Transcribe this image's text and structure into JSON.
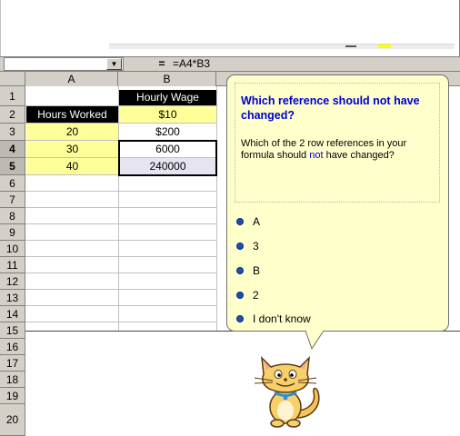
{
  "formula_bar": {
    "name_box_value": "",
    "equals": "=",
    "formula": "=A4*B3",
    "dropdown_glyph": "▼"
  },
  "grid": {
    "columns": [
      "A",
      "B"
    ],
    "rows": [
      "1",
      "2",
      "3",
      "4",
      "5",
      "6",
      "7",
      "8",
      "9",
      "10",
      "11",
      "12",
      "13",
      "14",
      "15",
      "16",
      "17",
      "18",
      "19",
      "20"
    ],
    "cells": {
      "b1": "Hourly Wage",
      "a2": "Hours Worked",
      "b2": "$10",
      "a3": "20",
      "b3": "$200",
      "a4": "30",
      "b4": "6000",
      "a5": "40",
      "b5": "240000"
    },
    "selected_rows": [
      "4",
      "5"
    ]
  },
  "callout": {
    "title": "Which reference should not have changed?",
    "body_before": "Which of the 2 row references in your formula should ",
    "body_highlight": "not",
    "body_after": " have changed?",
    "options": [
      "A",
      "3",
      "B",
      "2",
      "I don't know"
    ]
  },
  "assistant": {
    "icon": "cat-assistant-icon"
  },
  "colors": {
    "header_gray": "#d4d0c8",
    "input_yellow": "#ffff99",
    "header_black": "#000000",
    "callout_bg": "#ffffcc",
    "callout_title": "#0000cc",
    "option_dot": "#1a4fb8"
  }
}
